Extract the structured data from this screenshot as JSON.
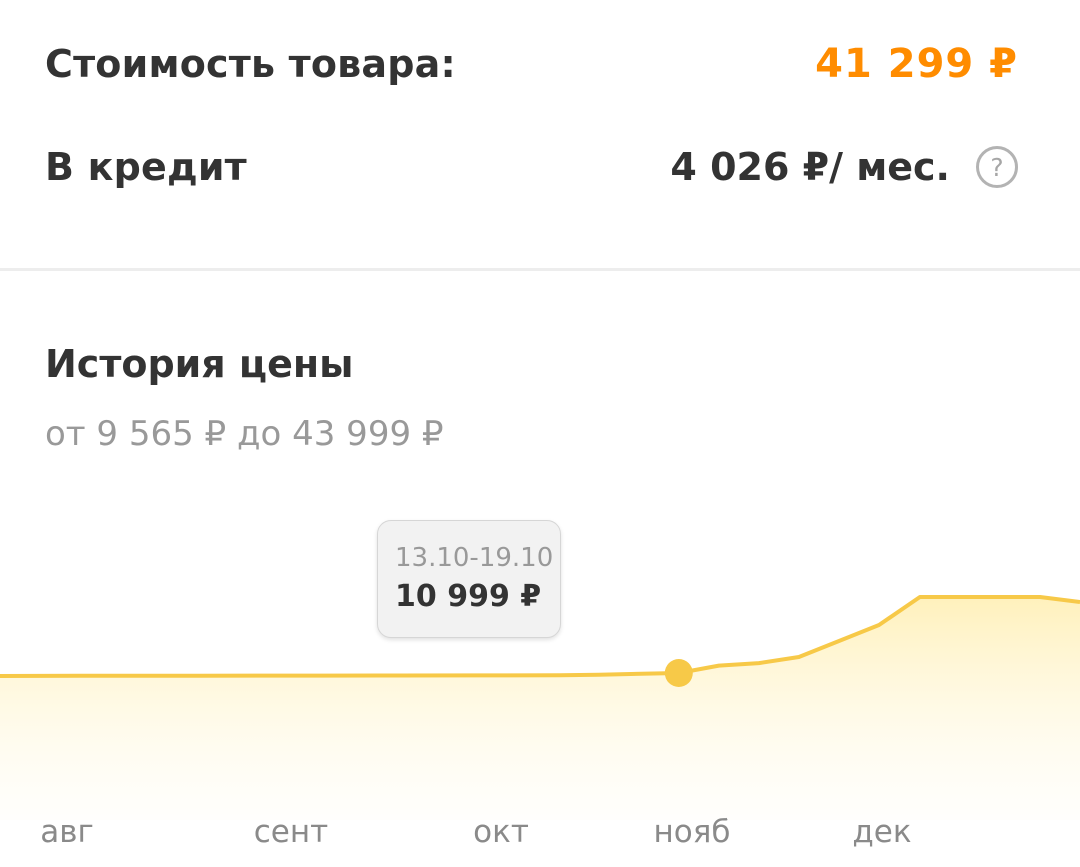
{
  "product_cost": {
    "label": "Стоимость товара:",
    "value": "41 299 ₽"
  },
  "credit": {
    "label": "В кредит",
    "value": "4 026 ₽/ мес.",
    "help_icon": "question-circle-icon"
  },
  "price_history": {
    "title": "История цены",
    "range": "от 9 565 ₽ до 43 999 ₽",
    "tooltip": {
      "period": "13.10-19.10",
      "price": "10 999 ₽"
    }
  },
  "colors": {
    "accent": "#ff8c00",
    "line": "#f7c948",
    "fill": "#fff3c4",
    "text": "#333333",
    "muted": "#999999"
  },
  "chart_data": {
    "type": "area",
    "months": [
      "авг",
      "сент",
      "окт",
      "нояб",
      "дек"
    ],
    "series": [
      {
        "values": [
          9565,
          9650,
          9700,
          9750,
          9800,
          9850,
          9900,
          10200,
          10999,
          11600,
          11800,
          12300,
          14800,
          19500,
          43999,
          43999,
          43999,
          43999,
          41299
        ]
      }
    ],
    "highlight_index": 8
  }
}
